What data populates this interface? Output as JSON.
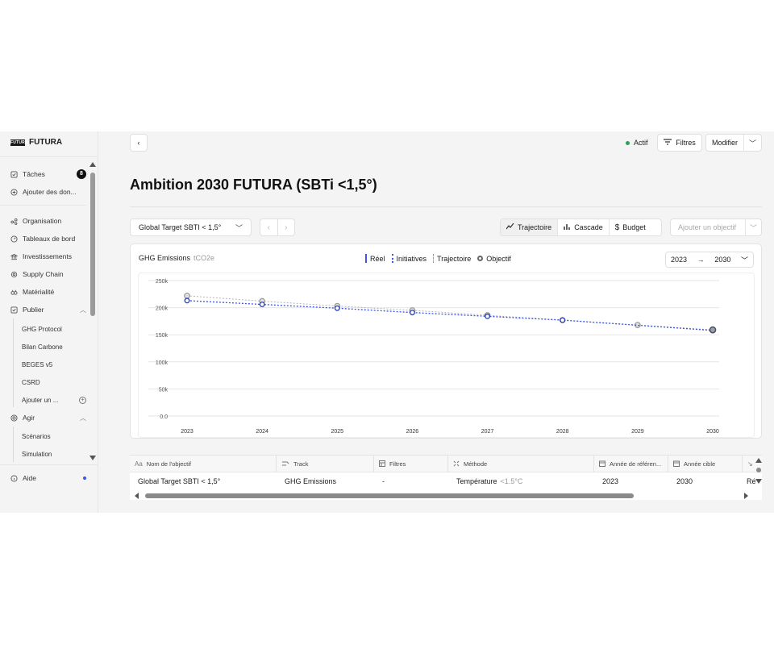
{
  "brand": {
    "logo": "FUTURA",
    "name": "FUTURA"
  },
  "sidebar": {
    "top_items": [
      {
        "label": "Tâches",
        "icon": "checkbox-icon",
        "badge": "8"
      },
      {
        "label": "Ajouter des don...",
        "icon": "plus-circle-icon"
      }
    ],
    "items": [
      {
        "label": "Organisation",
        "icon": "org-icon"
      },
      {
        "label": "Tableaux de bord",
        "icon": "dashboard-icon"
      },
      {
        "label": "Investissements",
        "icon": "bank-icon"
      },
      {
        "label": "Supply Chain",
        "icon": "supply-chain-icon"
      },
      {
        "label": "Matérialité",
        "icon": "materiality-icon"
      },
      {
        "label": "Publier",
        "icon": "publish-icon"
      }
    ],
    "publier_sub": [
      "GHG Protocol",
      "Bilan Carbone",
      "BEGES v5",
      "CSRD",
      "Ajouter un ..."
    ],
    "agir": {
      "label": "Agir",
      "icon": "target-icon"
    },
    "agir_sub": [
      "Scénarios",
      "Simulation"
    ],
    "aide": {
      "label": "Aide",
      "icon": "help-icon"
    }
  },
  "topbar": {
    "status": "Actif",
    "filters_label": "Filtres",
    "edit_label": "Modifier"
  },
  "page": {
    "title": "Ambition 2030 FUTURA (SBTi <1,5°)"
  },
  "controls": {
    "target_select": "Global Target SBTI < 1,5°",
    "views": [
      "Trajectoire",
      "Cascade",
      "Budget"
    ],
    "active_view": "Trajectoire",
    "add_objective_placeholder": "Ajouter un objectif"
  },
  "chart_header": {
    "title": "GHG Emissions",
    "unit": "tCO2e",
    "legend": [
      "Réel",
      "Initiatives",
      "Trajectoire",
      "Objectif"
    ],
    "range_from": "2023",
    "range_arrow": "→",
    "range_to": "2030"
  },
  "chart_data": {
    "type": "line",
    "x": [
      2023,
      2024,
      2025,
      2026,
      2027,
      2028,
      2029,
      2030
    ],
    "x_tick_labels": [
      "2023",
      "2024",
      "2025",
      "2026",
      "2027",
      "2028",
      "2029",
      "2030"
    ],
    "y_tick_labels": [
      "0.0",
      "50k",
      "100k",
      "150k",
      "200k",
      "250k"
    ],
    "y_ticks": [
      0,
      50000,
      100000,
      150000,
      200000,
      250000
    ],
    "ylim": [
      0,
      250000
    ],
    "grid": true,
    "series": [
      {
        "name": "Trajectoire",
        "values": [
          222000,
          212000,
          203000,
          195000,
          186000,
          177000,
          168000,
          159000
        ],
        "color": "#b5b5b5"
      },
      {
        "name": "Initiatives",
        "values": [
          213000,
          206000,
          199000,
          191000,
          184000,
          177000,
          null,
          158000
        ],
        "color": "#3b55e6"
      }
    ]
  },
  "table": {
    "columns": [
      {
        "label": "Nom de l'objectif",
        "icon": "text-icon"
      },
      {
        "label": "Track",
        "icon": "track-icon"
      },
      {
        "label": "Filtres",
        "icon": "filter-grid-icon"
      },
      {
        "label": "Méthode",
        "icon": "method-icon"
      },
      {
        "label": "Année de référen...",
        "icon": "calendar-icon"
      },
      {
        "label": "Année cible",
        "icon": "calendar-icon"
      }
    ],
    "rows": [
      {
        "name": "Global Target SBTI < 1,5°",
        "track": "GHG Emissions",
        "filters": "-",
        "method": "Température",
        "method_detail": "<1.5°C",
        "ref_year": "2023",
        "target_year": "2030",
        "extra": "Ré"
      }
    ]
  }
}
